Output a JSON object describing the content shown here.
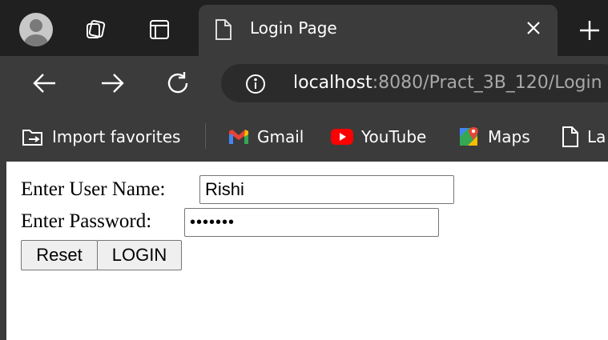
{
  "tab": {
    "title": "Login Page"
  },
  "address": {
    "host": "localhost",
    "path": ":8080/Pract_3B_120/Login"
  },
  "favorites": [
    {
      "label": "Import favorites",
      "icon": "import-favorites-icon"
    },
    {
      "label": "Gmail",
      "icon": "gmail-icon"
    },
    {
      "label": "YouTube",
      "icon": "youtube-icon"
    },
    {
      "label": "Maps",
      "icon": "maps-icon"
    },
    {
      "label": "La",
      "icon": "page-icon"
    }
  ],
  "form": {
    "username_label": "Enter User Name:",
    "username_value": "Rishi",
    "password_label": "Enter Password:",
    "password_value": "•••••••",
    "reset_label": "Reset",
    "login_label": "LOGIN"
  },
  "colors": {
    "tabstrip": "#202020",
    "toolbar": "#3b3b3b",
    "addressbar": "#2b2b2b",
    "gmail_red": "#ea4335",
    "youtube_red": "#ff0000"
  }
}
